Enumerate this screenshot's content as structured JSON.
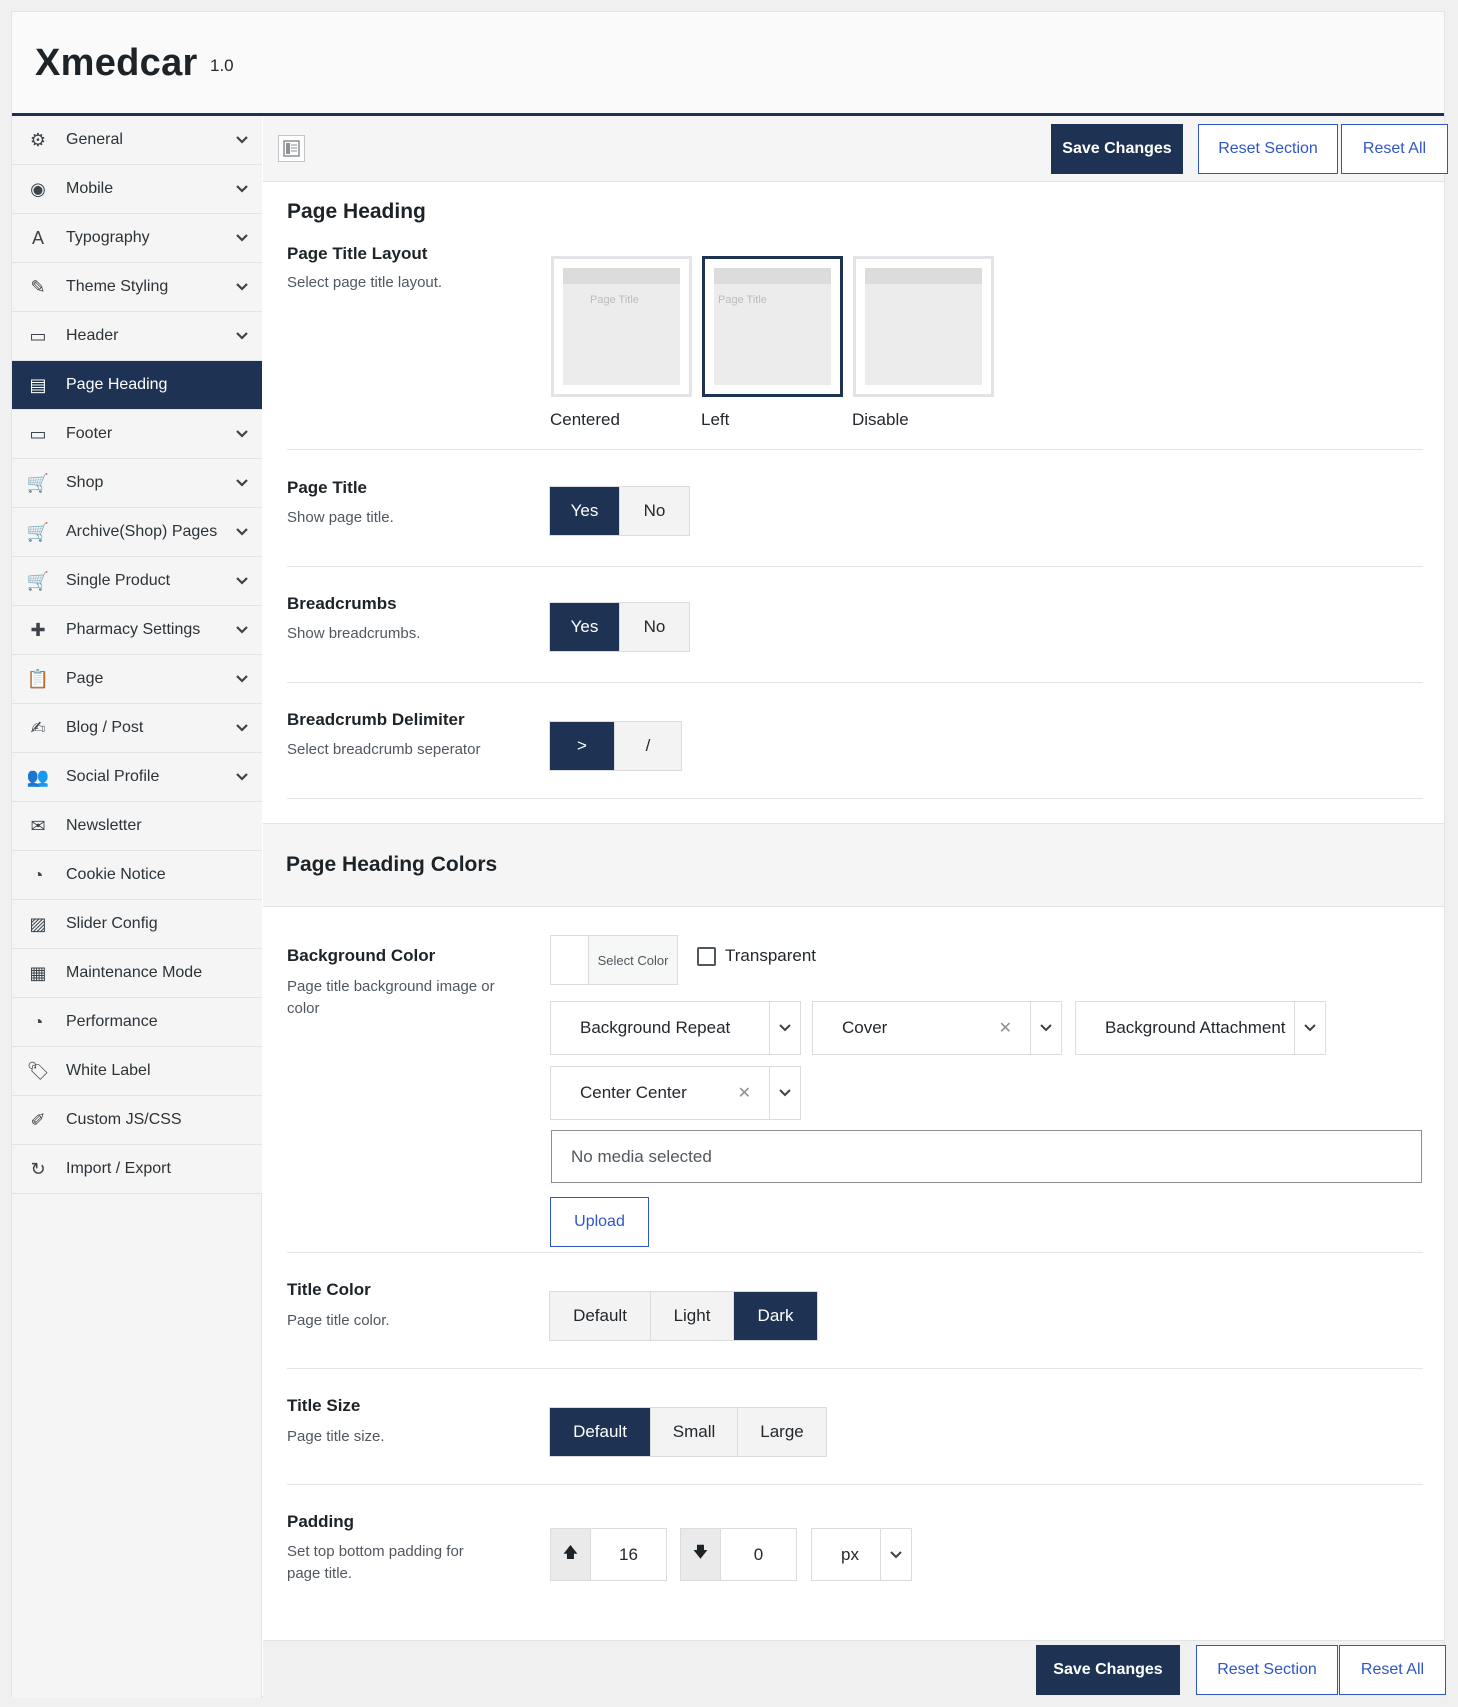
{
  "app": {
    "title": "Xmedcar",
    "version": "1.0"
  },
  "sidebar": {
    "items": [
      {
        "label": "General",
        "icon": "gear-icon",
        "chevron": true
      },
      {
        "label": "Mobile",
        "icon": "mobile-icon",
        "chevron": true
      },
      {
        "label": "Typography",
        "icon": "typography-icon",
        "chevron": true
      },
      {
        "label": "Theme Styling",
        "icon": "brush-icon",
        "chevron": true
      },
      {
        "label": "Header",
        "icon": "header-icon",
        "chevron": true
      },
      {
        "label": "Page Heading",
        "icon": "page-heading-icon",
        "chevron": false,
        "active": true
      },
      {
        "label": "Footer",
        "icon": "footer-icon",
        "chevron": true
      },
      {
        "label": "Shop",
        "icon": "cart-icon",
        "chevron": true
      },
      {
        "label": "Archive(Shop) Pages",
        "icon": "cart-icon",
        "chevron": true
      },
      {
        "label": "Single Product",
        "icon": "cart-icon",
        "chevron": true
      },
      {
        "label": "Pharmacy Settings",
        "icon": "plus-icon",
        "chevron": true
      },
      {
        "label": "Page",
        "icon": "clipboard-icon",
        "chevron": true
      },
      {
        "label": "Blog / Post",
        "icon": "edit-icon",
        "chevron": true
      },
      {
        "label": "Social Profile",
        "icon": "users-icon",
        "chevron": true
      },
      {
        "label": "Newsletter",
        "icon": "envelope-icon",
        "chevron": false
      },
      {
        "label": "Cookie Notice",
        "icon": "dashboard-icon",
        "chevron": false
      },
      {
        "label": "Slider Config",
        "icon": "image-icon",
        "chevron": false
      },
      {
        "label": "Maintenance Mode",
        "icon": "window-icon",
        "chevron": false
      },
      {
        "label": "Performance",
        "icon": "dashboard-icon",
        "chevron": false
      },
      {
        "label": "White Label",
        "icon": "tag-icon",
        "chevron": false
      },
      {
        "label": "Custom JS/CSS",
        "icon": "broom-icon",
        "chevron": false
      },
      {
        "label": "Import / Export",
        "icon": "refresh-icon",
        "chevron": false
      }
    ]
  },
  "toolbar": {
    "save_label": "Save Changes",
    "reset_section_label": "Reset Section",
    "reset_all_label": "Reset All"
  },
  "page_heading": {
    "section_title": "Page Heading",
    "layout": {
      "title": "Page Title Layout",
      "desc": "Select page title layout.",
      "options": [
        "Centered",
        "Left",
        "Disable"
      ],
      "selected": "Left",
      "preview_text": "Page Title"
    },
    "page_title": {
      "title": "Page Title",
      "desc": "Show page title.",
      "options": [
        "Yes",
        "No"
      ],
      "selected": "Yes"
    },
    "breadcrumbs": {
      "title": "Breadcrumbs",
      "desc": "Show breadcrumbs.",
      "options": [
        "Yes",
        "No"
      ],
      "selected": "Yes"
    },
    "delimiter": {
      "title": "Breadcrumb Delimiter",
      "desc": "Select breadcrumb seperator",
      "options": [
        ">",
        "/"
      ],
      "selected": ">"
    }
  },
  "colors": {
    "section_title": "Page Heading Colors",
    "background": {
      "title": "Background Color",
      "desc": "Page title background image or color",
      "select_color_label": "Select Color",
      "transparent_label": "Transparent",
      "transparent_checked": false,
      "repeat_placeholder": "Background Repeat",
      "size_value": "Cover",
      "attachment_placeholder": "Background Attachment",
      "position_value": "Center Center",
      "media_placeholder": "No media selected",
      "upload_label": "Upload"
    },
    "title_color": {
      "title": "Title Color",
      "desc": "Page title color.",
      "options": [
        "Default",
        "Light",
        "Dark"
      ],
      "selected": "Dark"
    },
    "title_size": {
      "title": "Title Size",
      "desc": "Page title size.",
      "options": [
        "Default",
        "Small",
        "Large"
      ],
      "selected": "Default"
    },
    "padding": {
      "title": "Padding",
      "desc": "Set top bottom padding for page title.",
      "top": "16",
      "bottom": "0",
      "unit": "px"
    }
  },
  "theme": {
    "accent": "#1e3354",
    "link": "#2f56c9"
  }
}
